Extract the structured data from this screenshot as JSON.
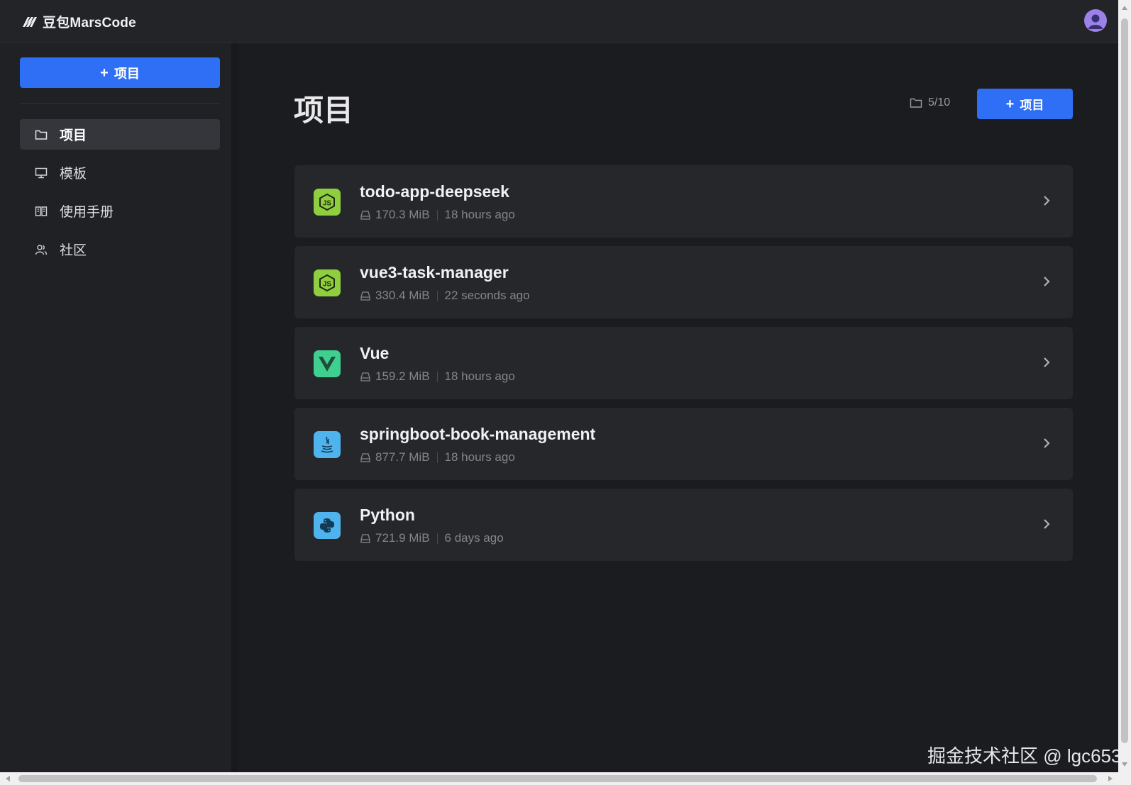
{
  "header": {
    "logo_text": "豆包MarsCode"
  },
  "sidebar": {
    "new_button": "项目",
    "items": [
      {
        "label": "项目",
        "icon": "folder-icon",
        "active": true
      },
      {
        "label": "模板",
        "icon": "monitor-icon",
        "active": false
      },
      {
        "label": "使用手册",
        "icon": "book-icon",
        "active": false
      },
      {
        "label": "社区",
        "icon": "users-icon",
        "active": false
      }
    ]
  },
  "main": {
    "title": "项目",
    "quota": "5/10",
    "new_button": "项目",
    "projects": [
      {
        "name": "todo-app-deepseek",
        "size": "170.3 MiB",
        "time": "18 hours ago",
        "icon": "nodejs-icon"
      },
      {
        "name": "vue3-task-manager",
        "size": "330.4 MiB",
        "time": "22 seconds ago",
        "icon": "nodejs-icon"
      },
      {
        "name": "Vue",
        "size": "159.2 MiB",
        "time": "18 hours ago",
        "icon": "vue-icon"
      },
      {
        "name": "springboot-book-management",
        "size": "877.7 MiB",
        "time": "18 hours ago",
        "icon": "java-icon"
      },
      {
        "name": "Python",
        "size": "721.9 MiB",
        "time": "6 days ago",
        "icon": "python-icon"
      }
    ]
  },
  "watermark": "掘金技术社区 @ lgc653",
  "colors": {
    "accent": "#2f6ff5",
    "background": "#1b1c20",
    "card": "#26272b",
    "sidebar": "#202125"
  }
}
